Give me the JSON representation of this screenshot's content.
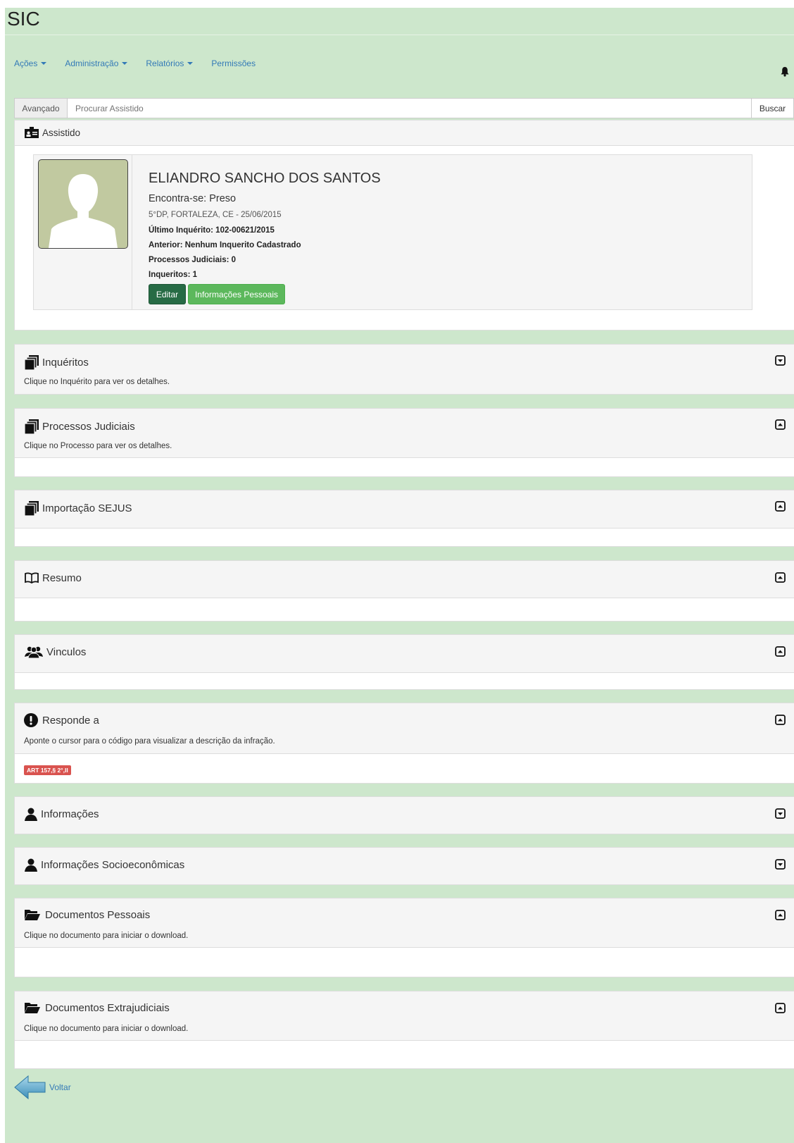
{
  "brand": "SIC",
  "nav": [
    {
      "label": "Ações",
      "dropdown": true
    },
    {
      "label": "Administração",
      "dropdown": true
    },
    {
      "label": "Relatórios",
      "dropdown": true
    },
    {
      "label": "Permissões",
      "dropdown": false
    }
  ],
  "search": {
    "advanced_label": "Avançado",
    "placeholder": "Procurar Assistido",
    "value": "",
    "button_label": "Buscar"
  },
  "assistido": {
    "panel_title": "Assistido",
    "name": "ELIANDRO SANCHO DOS SANTOS",
    "status": "Encontra-se: Preso",
    "location": "5°DP, FORTALEZA, CE - 25/06/2015",
    "ultimo_inquerito": "Último Inquérito: 102-00621/2015",
    "anterior": "Anterior: Nenhum Inquerito Cadastrado",
    "processos": "Processos Judiciais: 0",
    "inqueritos": "Inqueritos: 1",
    "edit_button": "Editar",
    "info_button": "Informações Pessoais"
  },
  "panels": {
    "inqueritos": {
      "title": "Inquéritos",
      "subtitle": "Clique no Inquérito para ver os detalhes."
    },
    "processos": {
      "title": "Processos Judiciais",
      "subtitle": "Clique no Processo para ver os detalhes."
    },
    "sejus": {
      "title": "Importação SEJUS"
    },
    "resumo": {
      "title": "Resumo"
    },
    "vinculos": {
      "title": "Vinculos"
    },
    "responde": {
      "title": "Responde a",
      "subtitle": "Aponte o cursor para o código para visualizar a descrição da infração.",
      "badge": "ART 157,§ 2°,II"
    },
    "informacoes": {
      "title": "Informações"
    },
    "socio": {
      "title": "Informações Socioeconômicas"
    },
    "docs_pessoais": {
      "title": "Documentos Pessoais",
      "subtitle": "Clique no documento para iniciar o download."
    },
    "docs_extra": {
      "title": "Documentos Extrajudiciais",
      "subtitle": "Clique no documento para iniciar o download."
    }
  },
  "back_label": "Voltar",
  "colors": {
    "background": "#cde7cc",
    "link": "#337ab7",
    "edit_button": "#276b45",
    "info_button": "#5cb85c",
    "badge": "#d9534f"
  }
}
